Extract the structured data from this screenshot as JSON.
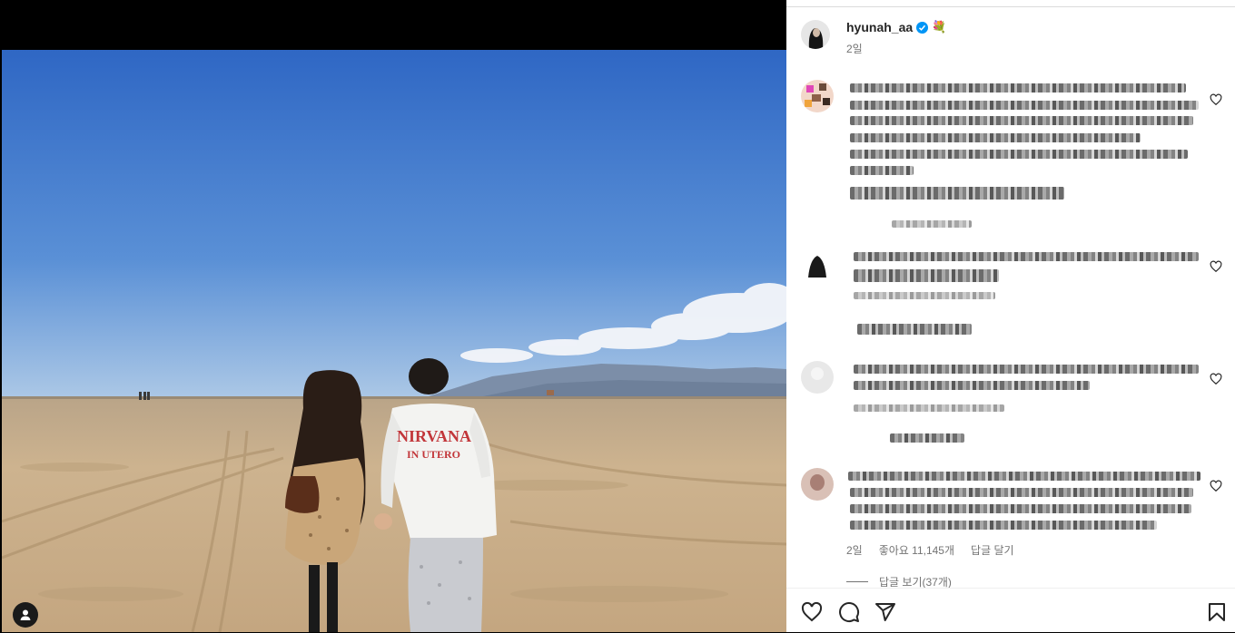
{
  "post": {
    "username": "hyunah_aa",
    "time": "2일",
    "emoji": "💐",
    "verified_icon": "verified-badge-icon"
  },
  "comment_meta": {
    "time": "2일",
    "likes": "좋아요 11,145개",
    "reply": "답글 달기"
  },
  "replies": {
    "label": "답글 보기(37개)"
  },
  "photo": {
    "shirt_text_line1": "NIRVANA",
    "shirt_text_line2": "IN UTERO"
  },
  "colors": {
    "sky_top": "#2f67c4",
    "sky_bottom": "#a9c6e6",
    "sand": "#c9ad87",
    "verified": "#0095f6"
  },
  "icons": [
    "heart-icon",
    "comment-icon",
    "share-icon",
    "bookmark-icon",
    "user-tag-icon"
  ]
}
